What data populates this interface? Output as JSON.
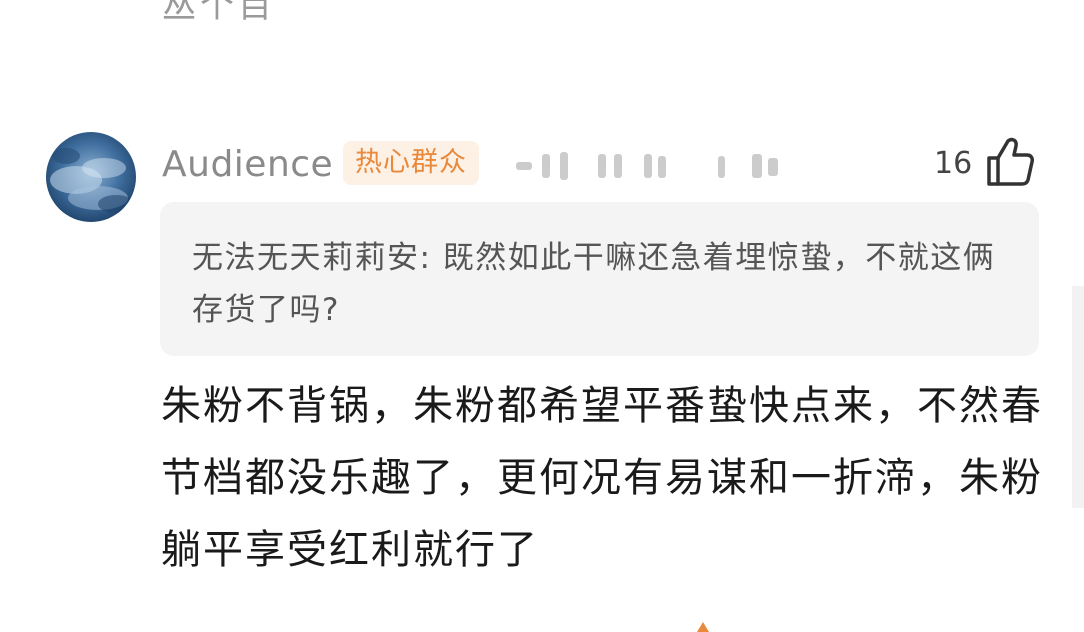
{
  "previous_comment_fragment": "丛个目",
  "comment": {
    "username": "Audience",
    "badge": "热心群众",
    "like_count": "16",
    "quote": {
      "author": "无法无天莉莉安",
      "separator": ": ",
      "text": "既然如此干嘛还急着埋惊蛰，不就这俩存货了吗?"
    },
    "body": "朱粉不背锅，朱粉都希望平番蛰快点来，不然春节档都没乐趣了，更何况有易谋和一折渧，朱粉躺平享受红利就行了"
  },
  "colors": {
    "badge_text": "#e8893c",
    "badge_bg": "#fdf0e4",
    "username": "#8a8a8a",
    "quote_bg": "#f4f4f4"
  },
  "icons": {
    "like": "thumbs-up-icon",
    "avatar": "sky-clouds-avatar"
  }
}
